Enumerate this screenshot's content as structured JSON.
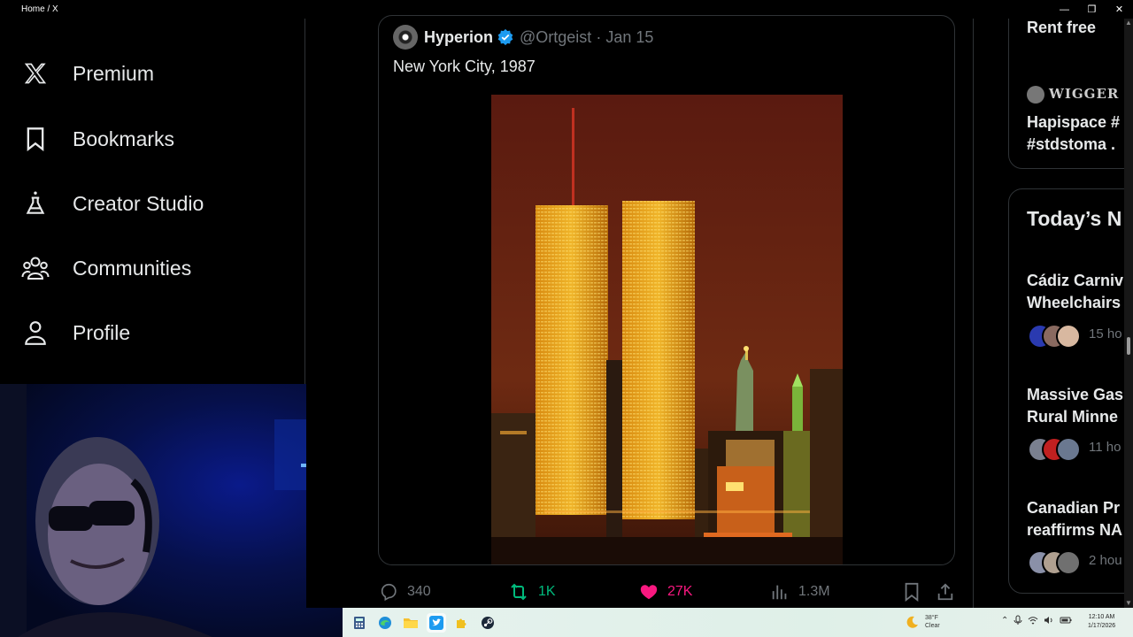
{
  "window": {
    "title": "Home / X",
    "controls": [
      "—",
      "❐",
      "✕"
    ]
  },
  "nav": {
    "items": [
      {
        "label": "Premium",
        "icon": "x-logo-icon"
      },
      {
        "label": "Bookmarks",
        "icon": "bookmark-icon"
      },
      {
        "label": "Creator Studio",
        "icon": "flask-icon"
      },
      {
        "label": "Communities",
        "icon": "people-icon"
      },
      {
        "label": "Profile",
        "icon": "person-icon"
      }
    ]
  },
  "quote": {
    "name": "Hyperion",
    "handle": "@Ortgeist",
    "dot": "·",
    "date": "Jan 15",
    "text": "New York City, 1987",
    "image_alt": "Twin Towers and Statue of Liberty at night"
  },
  "actions": {
    "replies": "340",
    "reposts": "1K",
    "likes": "27K",
    "views": "1.3M",
    "colors": {
      "repost": "#00ba7c",
      "like": "#f91880",
      "muted": "#71767b"
    }
  },
  "right": {
    "top_title": "Rent free",
    "sponsor_name": "WIGGER I",
    "sponsor_text_1": "Hapispace #",
    "sponsor_text_2": "#stdstoma .",
    "news_heading": "Today’s N",
    "news": [
      {
        "line1": "Cádiz Carniv",
        "line2": "Wheelchairs",
        "meta": "15 ho"
      },
      {
        "line1": "Massive Gas",
        "line2": "Rural Minne",
        "meta": "11 ho"
      },
      {
        "line1": "Canadian Pr",
        "line2": "reaffirms NA",
        "meta": "2 hou"
      }
    ]
  },
  "taskbar": {
    "weather_temp": "38°F",
    "weather_cond": "Clear",
    "time": "12:10 AM",
    "date": "1/17/2026"
  }
}
